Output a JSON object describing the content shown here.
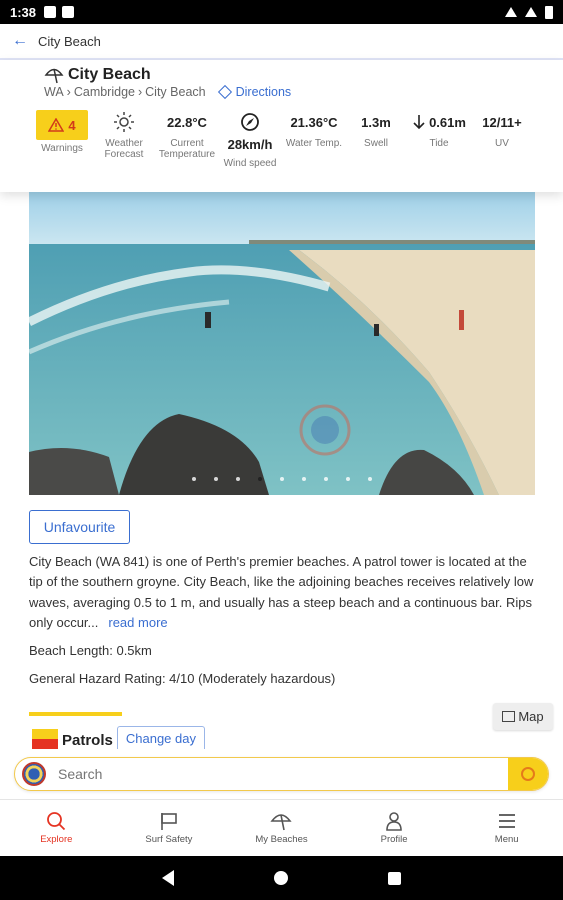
{
  "status_bar": {
    "time": "1:38"
  },
  "appbar": {
    "title": "City Beach"
  },
  "header": {
    "title": "City Beach",
    "breadcrumb": [
      "WA",
      "Cambridge",
      "City Beach"
    ],
    "directions": "Directions"
  },
  "stats": {
    "warnings": {
      "count": "4",
      "label": "Warnings"
    },
    "weather": {
      "label1": "Weather",
      "label2": "Forecast"
    },
    "temperature": {
      "value": "22.8°C",
      "label1": "Current",
      "label2": "Temperature"
    },
    "wind": {
      "value": "28km/h",
      "label": "Wind speed"
    },
    "water": {
      "value": "21.36°C",
      "label": "Water Temp."
    },
    "swell": {
      "value": "1.3m",
      "label": "Swell"
    },
    "tide": {
      "value": "0.61m",
      "label": "Tide"
    },
    "uv": {
      "value": "12/11+",
      "label": "UV"
    }
  },
  "gallery": {
    "dot_count": 9,
    "active_index": 3
  },
  "unfavourite_label": "Unfavourite",
  "description": {
    "text": "City Beach (WA 841) is one of Perth's premier beaches. A patrol tower is located at the tip of the southern groyne. City Beach, like the adjoining beaches receives relatively low waves, averaging 0.5 to 1 m, and usually has a steep beach and a continuous bar. Rips only occur...",
    "read_more": "read more"
  },
  "beach_length": "Beach Length: 0.5km",
  "hazard_rating": "General Hazard Rating: 4/10 (Moderately hazardous)",
  "patrols": {
    "label": "Patrols",
    "change_day": "Change day"
  },
  "map_label": "Map",
  "search": {
    "placeholder": "Search"
  },
  "bottom_nav": {
    "explore": "Explore",
    "surf_safety": "Surf Safety",
    "my_beaches": "My Beaches",
    "profile": "Profile",
    "menu": "Menu"
  },
  "colors": {
    "accent_blue": "#3a6ed0",
    "warning_yellow": "#f7cf1b",
    "active_red": "#e53322"
  }
}
